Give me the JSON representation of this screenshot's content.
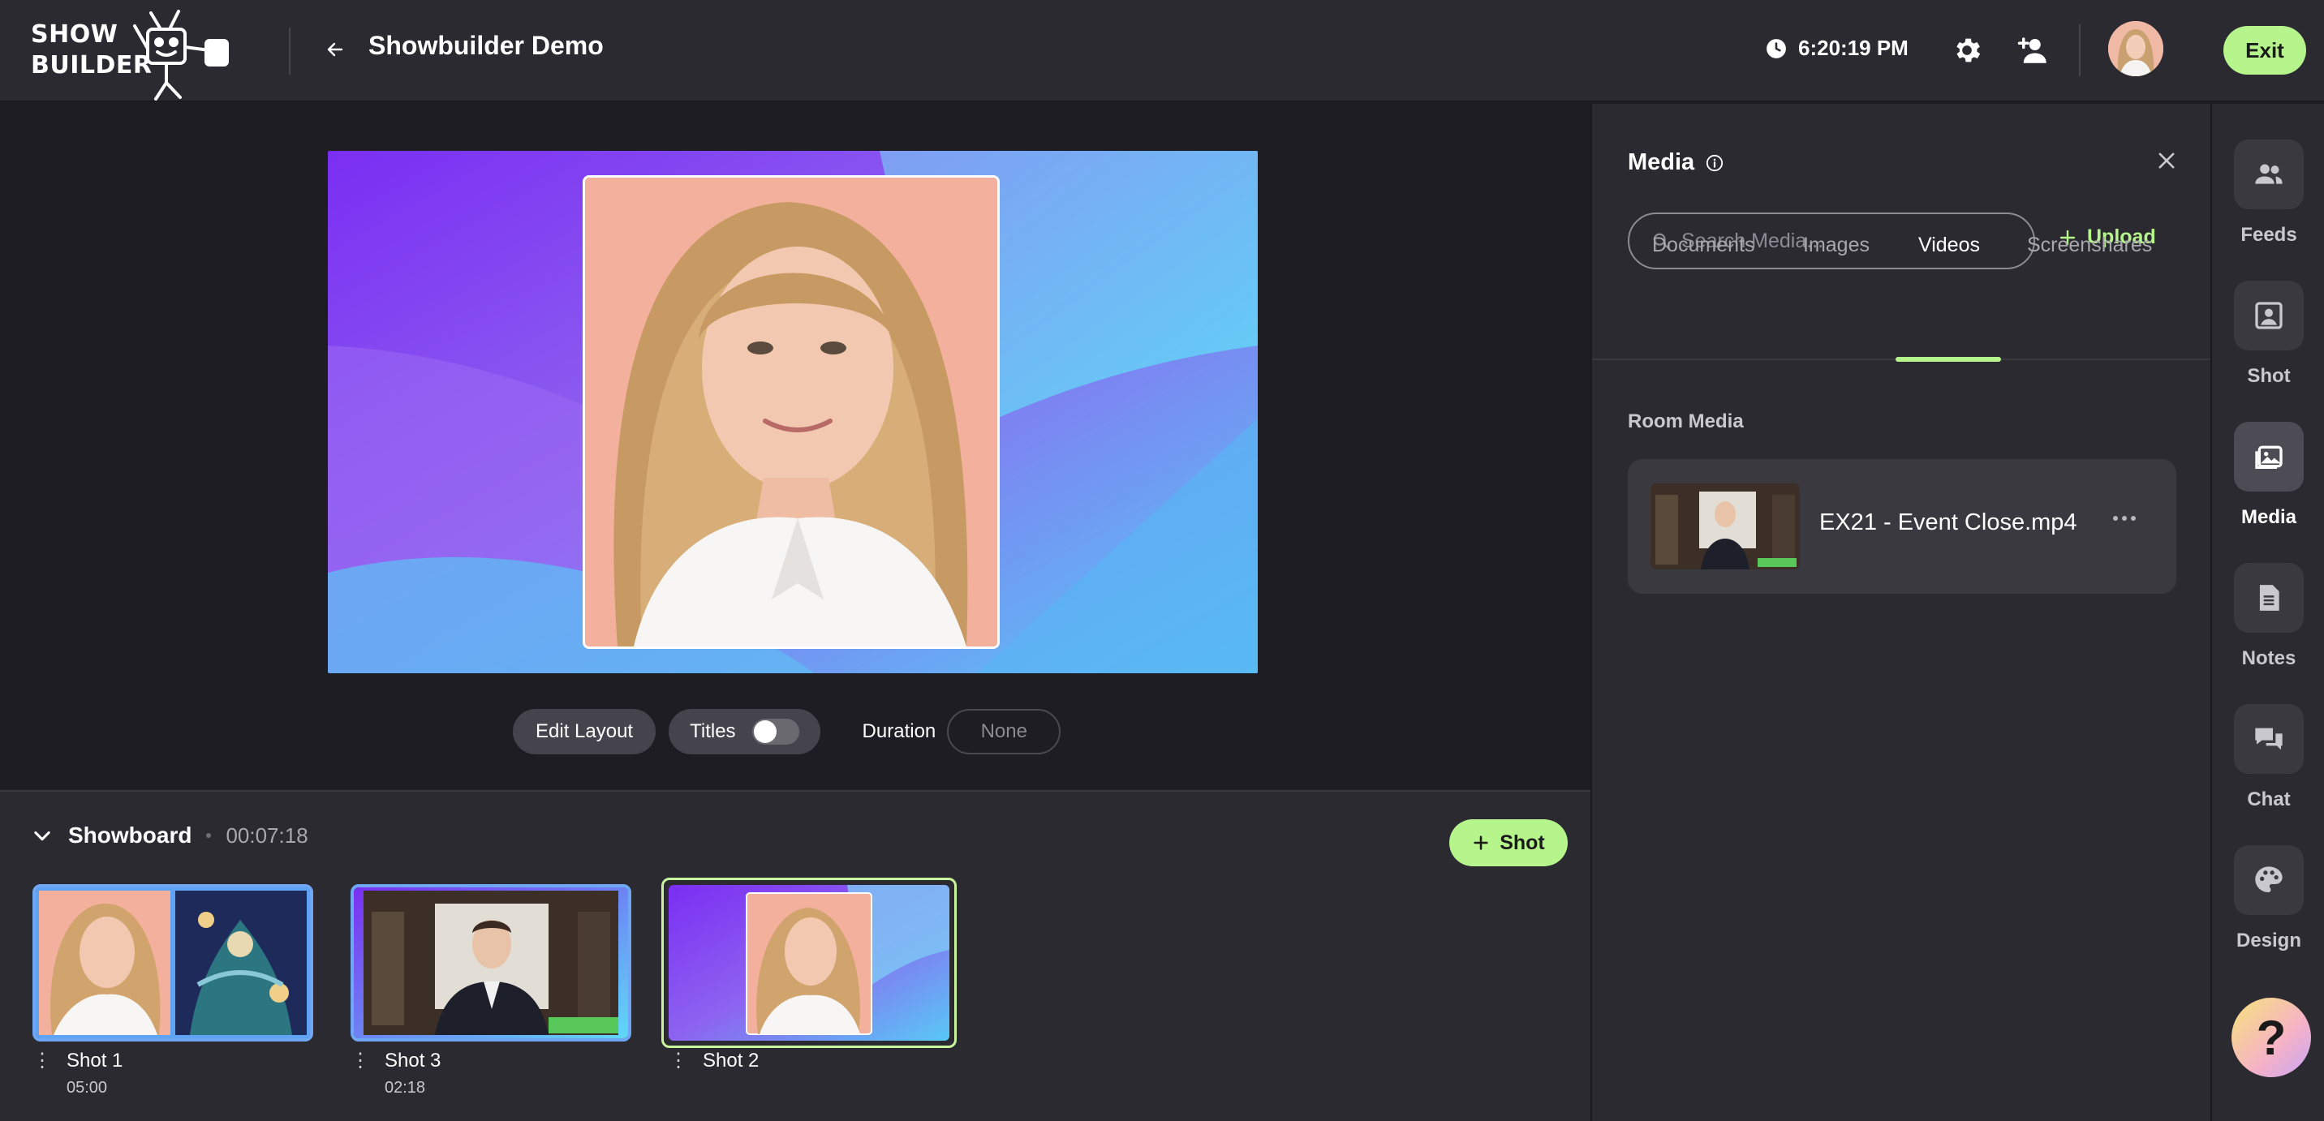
{
  "header": {
    "logo_line1": "SHOW",
    "logo_line2": "BUILDER",
    "title": "Showbuilder Demo",
    "time": "6:20:19 PM",
    "exit_label": "Exit"
  },
  "stage_controls": {
    "edit_layout_label": "Edit Layout",
    "titles_label": "Titles",
    "titles_on": false,
    "duration_label": "Duration",
    "duration_value": "None"
  },
  "showboard": {
    "title": "Showboard",
    "total_time": "00:07:18",
    "add_shot_label": "Shot",
    "shots": [
      {
        "name": "Shot 1",
        "duration": "05:00"
      },
      {
        "name": "Shot 3",
        "duration": "02:18"
      },
      {
        "name": "Shot 2",
        "duration": ""
      }
    ]
  },
  "media": {
    "title": "Media",
    "search_placeholder": "Search Media...",
    "upload_label": "Upload",
    "tabs": [
      "Documents",
      "Images",
      "Videos",
      "Screenshares"
    ],
    "active_tab": "Videos",
    "section_label": "Room Media",
    "items": [
      {
        "name": "EX21 - Event Close.mp4"
      }
    ]
  },
  "rail": {
    "items": [
      "Feeds",
      "Shot",
      "Media",
      "Notes",
      "Chat",
      "Design"
    ],
    "active": "Media",
    "help_label": "?"
  },
  "colors": {
    "accent": "#b6f58c",
    "panel": "#2b2a31",
    "stage_bg": "#1e1d23"
  }
}
